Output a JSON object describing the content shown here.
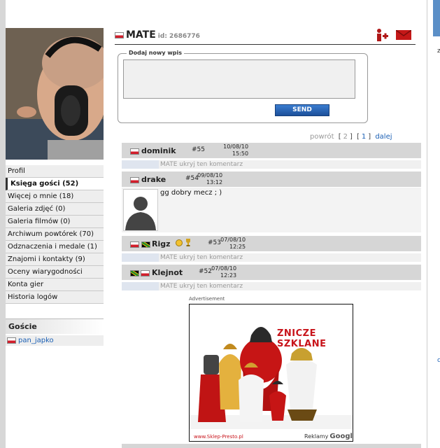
{
  "profile": {
    "name": "MATE",
    "id_label": "id: 2686776"
  },
  "menu": {
    "items": [
      {
        "label": "Profil",
        "active": false
      },
      {
        "label": "Księga gości (52)",
        "active": true
      },
      {
        "label": "Więcej o mnie (18)",
        "active": false
      },
      {
        "label": "Galeria zdjęć (0)",
        "active": false
      },
      {
        "label": "Galeria filmów (0)",
        "active": false
      },
      {
        "label": "Archiwum powtórek (70)",
        "active": false
      },
      {
        "label": "Odznaczenia i medale (1)",
        "active": false
      },
      {
        "label": "Znajomi i kontakty (9)",
        "active": false
      },
      {
        "label": "Oceny wiarygodności",
        "active": false
      },
      {
        "label": "Konta gier",
        "active": false
      },
      {
        "label": "Historia logów",
        "active": false
      }
    ]
  },
  "guests": {
    "title": "Goście",
    "items": [
      "pan_japko"
    ]
  },
  "form": {
    "legend": "Dodaj nowy wpis",
    "textarea_value": "",
    "send_label": "SEND"
  },
  "pager": {
    "prev": "powrót",
    "page_current": "2",
    "page_other": "1",
    "next": "dalej"
  },
  "entries": [
    {
      "author": "dominik",
      "flag": "pl",
      "number": "#55",
      "date": "10/08/10",
      "time": "15:50",
      "hidden": true,
      "hidden_text": "MATE ukryj ten komentarz"
    },
    {
      "author": "drake",
      "flag": "pl",
      "number": "#54",
      "date": "09/08/10",
      "time": "13:12",
      "hidden": false,
      "text": "gg dobry mecz ; )"
    },
    {
      "author": "Rigz",
      "flag": "pl-jm",
      "number": "#53",
      "date": "07/08/10",
      "time": "12:25",
      "hidden": true,
      "hidden_text": "MATE ukryj ten komentarz"
    },
    {
      "author": "Klejnot",
      "flag": "jm-pl",
      "number": "#52",
      "date": "07/08/10",
      "time": "12:23",
      "hidden": true,
      "hidden_text": "MATE ukryj ten komentarz"
    }
  ],
  "ad": {
    "label": "Advertisement",
    "title": "ZNICZE SZKLANE",
    "url": "www.Sklep-Presto.pl",
    "reklamy": "Reklamy",
    "google": "Google"
  },
  "colors": {
    "accent_blue": "#1a5fb4",
    "menu_bg": "#eeeeee",
    "entry_header": "#d6d6d6",
    "ad_red": "#c8131a"
  }
}
